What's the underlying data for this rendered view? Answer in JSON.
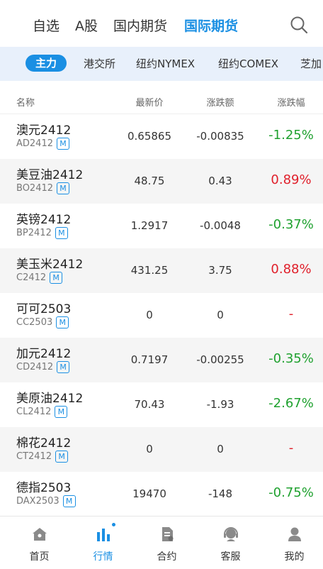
{
  "colors": {
    "accent": "#1a8fe3",
    "up": "#e0202b",
    "down": "#1fa12f"
  },
  "top_tabs": [
    {
      "label": "自选"
    },
    {
      "label": "A股"
    },
    {
      "label": "国内期货"
    },
    {
      "label": "国际期货",
      "active": true
    }
  ],
  "sub_tabs": [
    {
      "label": "主力",
      "active": true
    },
    {
      "label": "港交所"
    },
    {
      "label": "纽约NYMEX"
    },
    {
      "label": "纽约COMEX"
    },
    {
      "label": "芝加"
    }
  ],
  "table": {
    "headers": [
      "名称",
      "最新价",
      "涨跌额",
      "涨跌幅"
    ],
    "badge": "M",
    "rows": [
      {
        "name": "澳元2412",
        "code": "AD2412",
        "price": "0.65865",
        "change": "-0.00835",
        "pct": "-1.25%",
        "dir": "down"
      },
      {
        "name": "美豆油2412",
        "code": "BO2412",
        "price": "48.75",
        "change": "0.43",
        "pct": "0.89%",
        "dir": "up"
      },
      {
        "name": "英镑2412",
        "code": "BP2412",
        "price": "1.2917",
        "change": "-0.0048",
        "pct": "-0.37%",
        "dir": "down"
      },
      {
        "name": "美玉米2412",
        "code": "C2412",
        "price": "431.25",
        "change": "3.75",
        "pct": "0.88%",
        "dir": "up"
      },
      {
        "name": "可可2503",
        "code": "CC2503",
        "price": "0",
        "change": "0",
        "pct": "-",
        "dir": "flat"
      },
      {
        "name": "加元2412",
        "code": "CD2412",
        "price": "0.7197",
        "change": "-0.00255",
        "pct": "-0.35%",
        "dir": "down"
      },
      {
        "name": "美原油2412",
        "code": "CL2412",
        "price": "70.43",
        "change": "-1.93",
        "pct": "-2.67%",
        "dir": "down"
      },
      {
        "name": "棉花2412",
        "code": "CT2412",
        "price": "0",
        "change": "0",
        "pct": "-",
        "dir": "flat"
      },
      {
        "name": "德指2503",
        "code": "DAX2503",
        "price": "19470",
        "change": "-148",
        "pct": "-0.75%",
        "dir": "down"
      }
    ]
  },
  "bottom_nav": [
    {
      "label": "首页",
      "icon": "home-icon"
    },
    {
      "label": "行情",
      "icon": "market-chart-icon",
      "active": true
    },
    {
      "label": "合约",
      "icon": "contract-document-icon"
    },
    {
      "label": "客服",
      "icon": "customer-service-icon"
    },
    {
      "label": "我的",
      "icon": "user-profile-icon"
    }
  ]
}
